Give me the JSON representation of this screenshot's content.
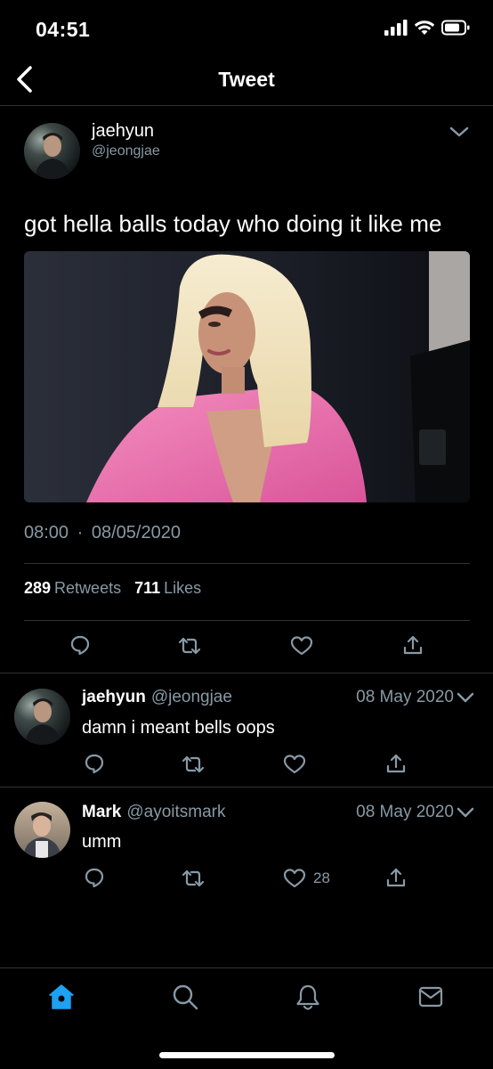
{
  "status_bar": {
    "time": "04:51"
  },
  "nav": {
    "title": "Tweet"
  },
  "tweet": {
    "author_name": "jaehyun",
    "author_handle": "@jeongjae",
    "text": "got hella balls today who doing it like me",
    "time": "08:00",
    "separator": "·",
    "date": "08/05/2020",
    "retweets_count": "289",
    "retweets_label": "Retweets",
    "likes_count": "711",
    "likes_label": "Likes"
  },
  "replies": [
    {
      "name": "jaehyun",
      "handle": "@jeongjae",
      "date": "08 May 2020",
      "text": "damn i meant bells oops",
      "like_count": ""
    },
    {
      "name": "Mark",
      "handle": "@ayoitsmark",
      "date": "08 May 2020",
      "text": "umm",
      "like_count": "28"
    }
  ],
  "colors": {
    "accent": "#1da1f2",
    "muted": "#8899a6",
    "divider": "#2f3336",
    "background": "#000000"
  },
  "icons": [
    "chevron-left-icon",
    "chevron-down-icon",
    "reply-icon",
    "retweet-icon",
    "like-icon",
    "share-icon",
    "home-icon",
    "search-icon",
    "notifications-icon",
    "messages-icon"
  ]
}
